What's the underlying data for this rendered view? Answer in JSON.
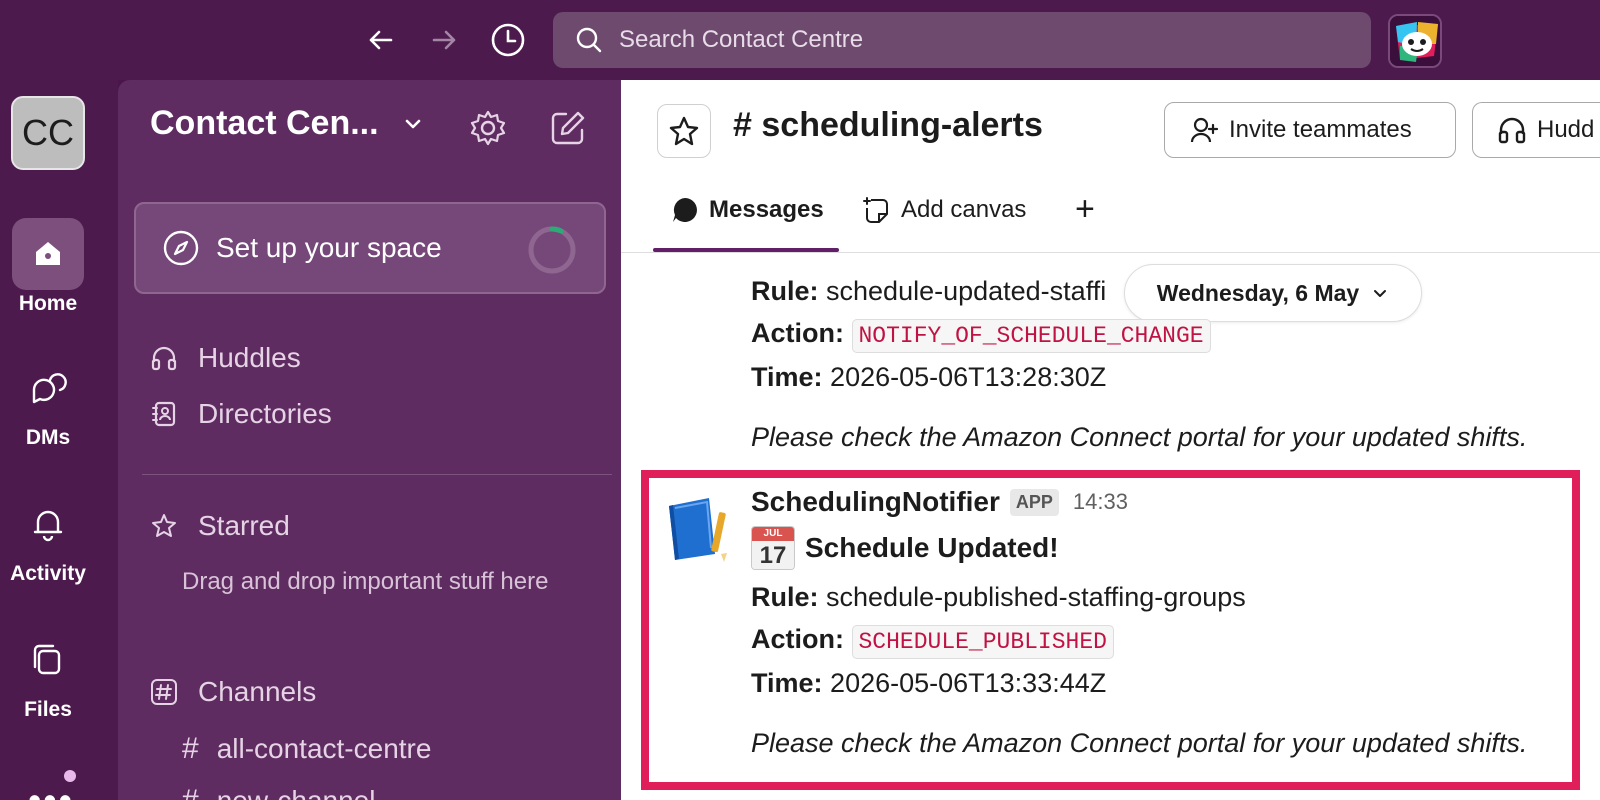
{
  "topbar": {
    "search_placeholder": "Search Contact Centre"
  },
  "workspace": {
    "initials": "CC",
    "name": "Contact Cen..."
  },
  "rail": {
    "home": "Home",
    "dms": "DMs",
    "activity": "Activity",
    "files": "Files",
    "more": "•••"
  },
  "sidebar": {
    "setup_label": "Set up your space",
    "huddles": "Huddles",
    "directories": "Directories",
    "starred": "Starred",
    "starred_hint": "Drag and drop important stuff here",
    "channels": "Channels",
    "channel_list": [
      "all-contact-centre",
      "new-channel"
    ]
  },
  "channel": {
    "hash": "#",
    "name": "scheduling-alerts",
    "invite_label": "Invite teammates",
    "huddle_label": "Hudd"
  },
  "tabs": {
    "messages": "Messages",
    "add_canvas": "Add canvas",
    "plus": "+"
  },
  "date_divider": "Wednesday, 6 May",
  "messages": [
    {
      "rule_label": "Rule:",
      "rule": "schedule-updated-staffi",
      "action_label": "Action:",
      "action": "NOTIFY_OF_SCHEDULE_CHANGE",
      "time_label": "Time:",
      "time": "2026-05-06T13:28:30Z",
      "note": "Please check the Amazon Connect portal for your updated shifts."
    },
    {
      "sender": "SchedulingNotifier",
      "badge": "APP",
      "timestamp": "14:33",
      "calendar_month": "JUL",
      "calendar_day": "17",
      "heading": "Schedule Updated!",
      "rule_label": "Rule:",
      "rule": "schedule-published-staffing-groups",
      "action_label": "Action:",
      "action": "SCHEDULE_PUBLISHED",
      "time_label": "Time:",
      "time": "2026-05-06T13:33:44Z",
      "note": "Please check the Amazon Connect portal for your updated shifts."
    }
  ],
  "colors": {
    "aubergine": "#4a154b",
    "sidebar": "#5e2c60",
    "highlight": "#e01e5a",
    "code_text": "#c01343"
  }
}
